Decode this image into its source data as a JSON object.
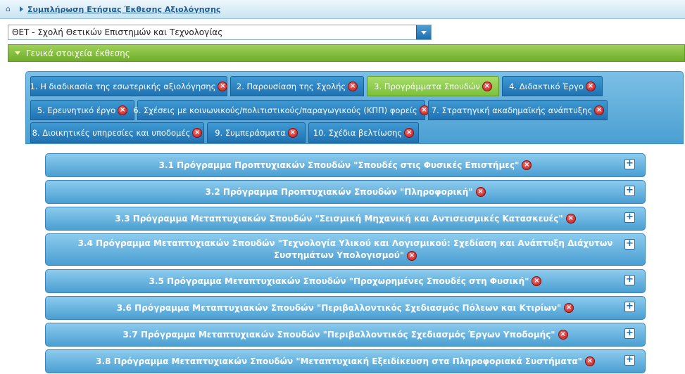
{
  "breadcrumb": {
    "icon": "home-icon",
    "link": "Συμπλήρωση Ετήσιας Έκθεσης Αξιολόγησης"
  },
  "school_select": {
    "value": "ΘΕΤ - Σχολή Θετικών Επιστημών και Τεχνολογίας"
  },
  "section": {
    "title": "Γενικά στοιχεία έκθεσης"
  },
  "tabs": [
    {
      "label": "1. Η διαδικασία της εσωτερικής αξιολόγησης",
      "active": false
    },
    {
      "label": "2. Παρουσίαση της Σχολής",
      "active": false
    },
    {
      "label": "3. Προγράμματα Σπουδών",
      "active": true
    },
    {
      "label": "4. Διδακτικό Έργο",
      "active": false
    },
    {
      "label": "5. Ερευνητικό έργο",
      "active": false
    },
    {
      "label": "6. Σχέσεις με κοινωνικούς/πολιτιστικούς/παραγωγικούς (ΚΠΠ) φορείς",
      "active": false
    },
    {
      "label": "7. Στρατηγική ακαδημαϊκής ανάπτυξης",
      "active": false
    },
    {
      "label": "8. Διοικητικές υπηρεσίες και υποδομές",
      "active": false
    },
    {
      "label": "9. Συμπεράσματα",
      "active": false
    },
    {
      "label": "10. Σχέδια βελτίωσης",
      "active": false
    }
  ],
  "programs": [
    {
      "title": "3.1 Πρόγραμμα Προπτυχιακών Σπουδών \"Σπουδές στις Φυσικές Επιστήμες\""
    },
    {
      "title": "3.2 Πρόγραμμα Προπτυχιακών Σπουδών \"Πληροφορική\""
    },
    {
      "title": "3.3 Πρόγραμμα Μεταπτυχιακών Σπουδών \"Σεισμική Μηχανική και Αντισεισμικές Κατασκευές\""
    },
    {
      "title": "3.4 Πρόγραμμα Μεταπτυχιακών Σπουδών \"Τεχνολογία Υλικού και Λογισμικού: Σχεδίαση και Ανάπτυξη Διάχυτων Συστημάτων Υπολογισμού\""
    },
    {
      "title": "3.5 Πρόγραμμα Μεταπτυχιακών Σπουδών \"Προχωρημένες Σπουδές στη Φυσική\""
    },
    {
      "title": "3.6 Πρόγραμμα Μεταπτυχιακών Σπουδών \"Περιβαλλοντικός Σχεδιασμός Πόλεων και Κτιρίων\""
    },
    {
      "title": "3.7 Πρόγραμμα Μεταπτυχιακών Σπουδών \"Περιβαλλοντικός Σχεδιασμός Έργων Υποδομής\""
    },
    {
      "title": "3.8 Πρόγραμμα Μεταπτυχιακών Σπουδών \"Μεταπτυχιακή Εξειδίκευση στα Πληροφοριακά Συστήματα\""
    }
  ],
  "icons": {
    "remove": "remove-icon",
    "expand": "expand-plus-icon"
  },
  "colors": {
    "accent_blue": "#1f72b3",
    "active_green": "#7cc23a",
    "remove_red": "#c01818"
  }
}
